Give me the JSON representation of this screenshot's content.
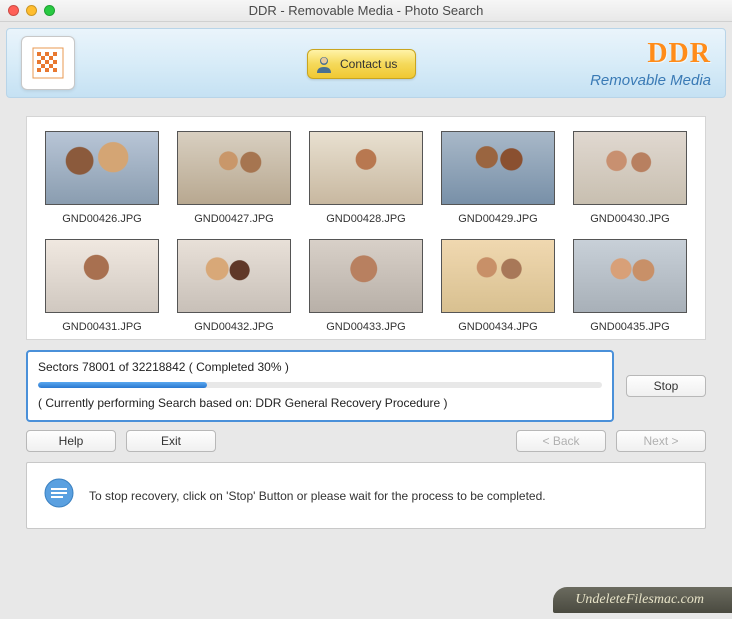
{
  "window": {
    "title": "DDR - Removable Media - Photo Search"
  },
  "header": {
    "contact_label": "Contact us",
    "brand": "DDR",
    "brand_sub": "Removable Media"
  },
  "photos": [
    {
      "name": "GND00426.JPG"
    },
    {
      "name": "GND00427.JPG"
    },
    {
      "name": "GND00428.JPG"
    },
    {
      "name": "GND00429.JPG"
    },
    {
      "name": "GND00430.JPG"
    },
    {
      "name": "GND00431.JPG"
    },
    {
      "name": "GND00432.JPG"
    },
    {
      "name": "GND00433.JPG"
    },
    {
      "name": "GND00434.JPG"
    },
    {
      "name": "GND00435.JPG"
    }
  ],
  "progress": {
    "sectors_current": 78001,
    "sectors_total": 32218842,
    "percent": 30,
    "status_line": "Sectors 78001 of 32218842   ( Completed   30% )",
    "detail": "( Currently performing Search based on: DDR General Recovery Procedure )"
  },
  "buttons": {
    "stop": "Stop",
    "help": "Help",
    "exit": "Exit",
    "back": "< Back",
    "next": "Next >"
  },
  "tip": {
    "text": "To stop recovery, click on 'Stop' Button or please wait for the process to be completed."
  },
  "footer": {
    "site": "UndeleteFilesmac.com"
  }
}
